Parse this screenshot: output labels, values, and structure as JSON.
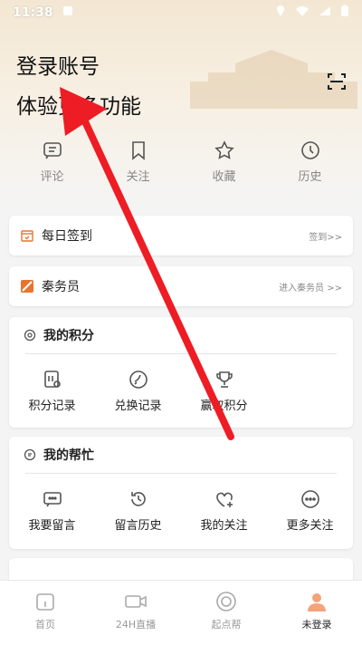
{
  "status_bar": {
    "time": "11:38"
  },
  "login": {
    "line1": "登录账号",
    "line2": "体验更多功能"
  },
  "quick_actions": [
    {
      "label": "评论",
      "icon": "comment-icon"
    },
    {
      "label": "关注",
      "icon": "bookmark-icon"
    },
    {
      "label": "收藏",
      "icon": "star-icon"
    },
    {
      "label": "历史",
      "icon": "clock-icon"
    }
  ],
  "checkin": {
    "title": "每日签到",
    "action": "签到>>"
  },
  "qinwuyuan": {
    "title": "秦务员",
    "action": "进入秦务员 >>"
  },
  "points": {
    "title": "我的积分",
    "items": [
      {
        "label": "积分记录",
        "icon": "points-record-icon"
      },
      {
        "label": "兑换记录",
        "icon": "exchange-record-icon"
      },
      {
        "label": "赢取积分",
        "icon": "trophy-icon"
      }
    ]
  },
  "help": {
    "title": "我的帮忙",
    "items": [
      {
        "label": "我要留言",
        "icon": "message-icon"
      },
      {
        "label": "留言历史",
        "icon": "message-history-icon"
      },
      {
        "label": "我的关注",
        "icon": "heart-plus-icon"
      },
      {
        "label": "更多关注",
        "icon": "more-icon"
      }
    ]
  },
  "tabs": [
    {
      "label": "首页",
      "icon": "home-icon"
    },
    {
      "label": "24H直播",
      "icon": "live-camera-icon"
    },
    {
      "label": "起点帮",
      "icon": "target-icon"
    },
    {
      "label": "未登录",
      "icon": "user-avatar-icon"
    }
  ],
  "colors": {
    "accent": "#ee3a2c",
    "arrow": "#ee1c25",
    "avatar": "#f4a37a",
    "brand_orange": "#e8742e"
  }
}
